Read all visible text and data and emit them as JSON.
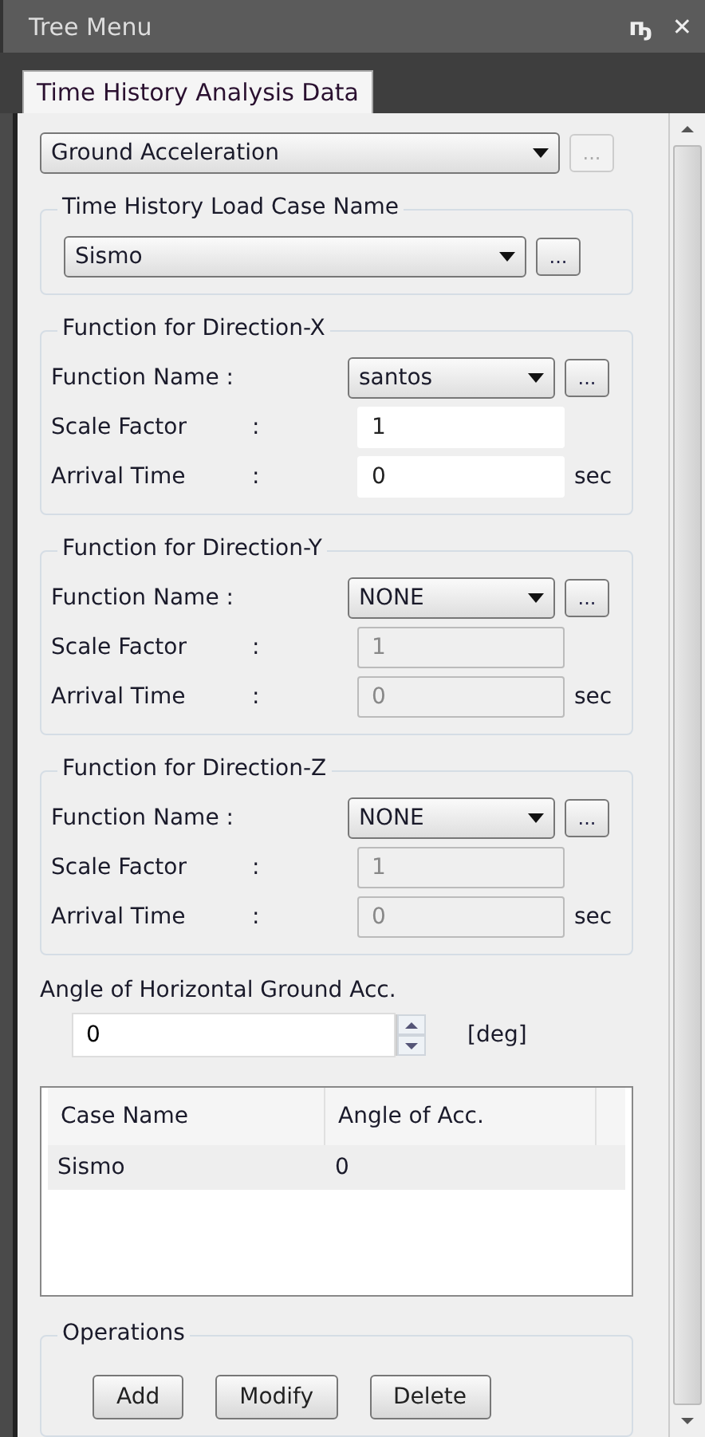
{
  "window": {
    "title": "Tree Menu",
    "controls": [
      "ҧ",
      "✕"
    ]
  },
  "tabs": [
    {
      "label": "Time History Analysis Data",
      "selected": true
    }
  ],
  "type_select": {
    "value": "Ground Acceleration",
    "more_disabled": true,
    "more": "..."
  },
  "load_case": {
    "title": "Time History Load Case Name",
    "value": "Sismo",
    "more": "..."
  },
  "directions": [
    {
      "title": "Function for Direction-X",
      "function_label": "Function Name :",
      "function": "santos",
      "more": "...",
      "scale_label": "Scale Factor",
      "scale": "1",
      "arrival_label": "Arrival Time",
      "arrival": "0",
      "unit": "sec",
      "colon": ":",
      "disabled": false
    },
    {
      "title": "Function for Direction-Y",
      "function_label": "Function Name :",
      "function": "NONE",
      "more": "...",
      "scale_label": "Scale Factor",
      "scale": "1",
      "arrival_label": "Arrival Time",
      "arrival": "0",
      "unit": "sec",
      "colon": ":",
      "disabled": true
    },
    {
      "title": "Function for Direction-Z",
      "function_label": "Function Name :",
      "function": "NONE",
      "more": "...",
      "scale_label": "Scale Factor",
      "scale": "1",
      "arrival_label": "Arrival Time",
      "arrival": "0",
      "unit": "sec",
      "colon": ":",
      "disabled": true
    }
  ],
  "angle": {
    "label": "Angle of Horizontal Ground Acc.",
    "value": "0",
    "unit": "[deg]"
  },
  "table": {
    "columns": [
      "Case Name",
      "Angle of Acc."
    ],
    "rows": [
      {
        "cells": [
          "Sismo",
          "0"
        ],
        "selected": true
      }
    ]
  },
  "operations": {
    "title": "Operations",
    "buttons": [
      "Add",
      "Modify",
      "Delete"
    ]
  }
}
